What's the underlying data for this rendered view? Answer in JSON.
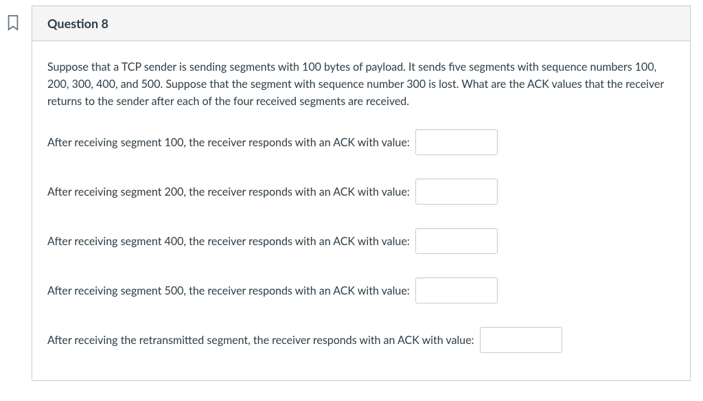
{
  "header": {
    "title": "Question 8",
    "points": ""
  },
  "body": {
    "prompt": "Suppose that a TCP sender is sending segments with 100 bytes of payload. It sends five segments with sequence numbers 100, 200, 300, 400, and 500. Suppose that the segment with sequence number 300 is lost. What are the ACK values that the receiver returns to the sender after each of the four received segments are received.",
    "rows": [
      {
        "label": "After receiving segment 100, the receiver responds with an ACK with value:",
        "value": ""
      },
      {
        "label": "After receiving segment 200, the receiver responds with an ACK with value:",
        "value": ""
      },
      {
        "label": "After receiving segment 400, the receiver responds with an ACK with value:",
        "value": ""
      },
      {
        "label": "After receiving segment 500, the receiver responds with an ACK with value:",
        "value": ""
      },
      {
        "label": "After receiving the retransmitted segment, the receiver responds with an ACK with value:",
        "value": ""
      }
    ]
  }
}
